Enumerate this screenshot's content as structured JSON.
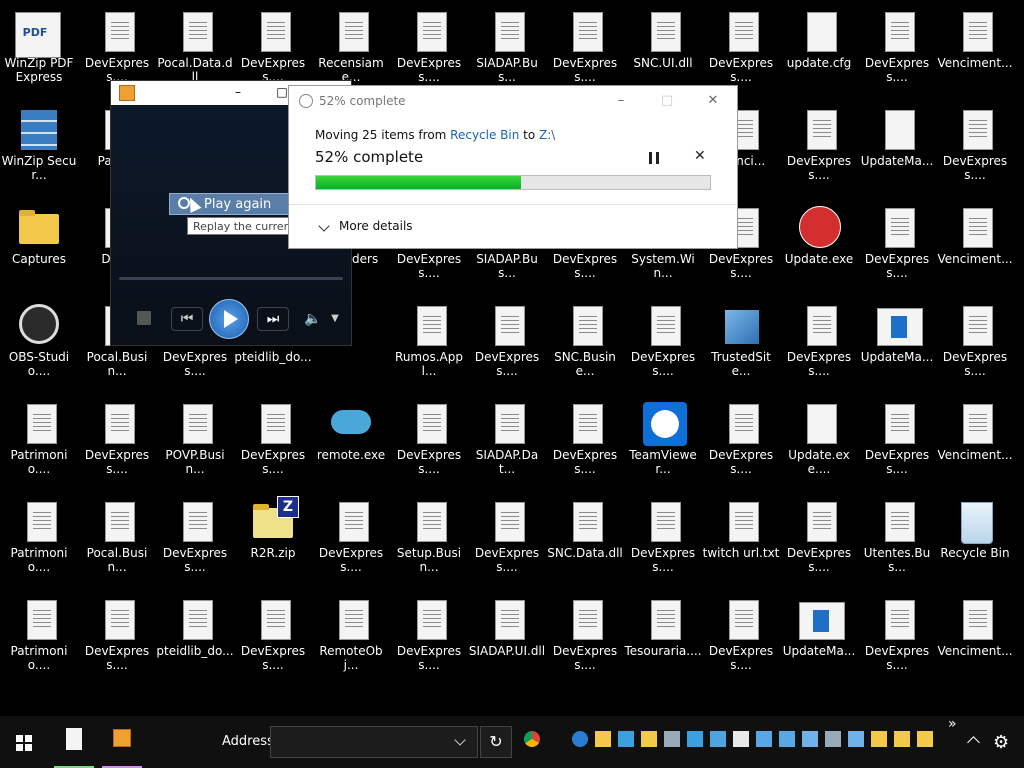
{
  "desktop_icons": [
    {
      "label": "WinZip PDF Express",
      "icon": "winzip-pdf-icon",
      "col": 0,
      "row": 0,
      "style": "pdf"
    },
    {
      "label": "DevExpress....",
      "icon": "file-icon",
      "col": 1,
      "row": 0
    },
    {
      "label": "Pocal.Data.dll",
      "icon": "file-icon",
      "col": 2,
      "row": 0
    },
    {
      "label": "DevExpress....",
      "icon": "file-icon",
      "col": 3,
      "row": 0
    },
    {
      "label": "Recensiame...",
      "icon": "file-icon",
      "col": 4,
      "row": 0
    },
    {
      "label": "DevExpress....",
      "icon": "file-icon",
      "col": 5,
      "row": 0
    },
    {
      "label": "SIADAP.Bus...",
      "icon": "file-icon",
      "col": 6,
      "row": 0
    },
    {
      "label": "DevExpress....",
      "icon": "file-icon",
      "col": 7,
      "row": 0
    },
    {
      "label": "SNC.UI.dll",
      "icon": "file-icon",
      "col": 8,
      "row": 0
    },
    {
      "label": "DevExpress....",
      "icon": "file-icon",
      "col": 9,
      "row": 0
    },
    {
      "label": "update.cfg",
      "icon": "blank-file-icon",
      "col": 10,
      "row": 0,
      "style": "blank"
    },
    {
      "label": "DevExpress....",
      "icon": "file-icon",
      "col": 11,
      "row": 0
    },
    {
      "label": "Venciment...",
      "icon": "file-icon",
      "col": 12,
      "row": 0
    },
    {
      "label": "WinZip Secur...",
      "icon": "winzip-secure-icon",
      "col": 0,
      "row": 1,
      "style": "server"
    },
    {
      "label": "Patrim",
      "icon": "file-icon",
      "col": 1,
      "row": 1
    },
    {
      "label": "erenci...",
      "icon": "file-icon",
      "col": 9,
      "row": 1
    },
    {
      "label": "DevExpress....",
      "icon": "file-icon",
      "col": 10,
      "row": 1
    },
    {
      "label": "UpdateMa...",
      "icon": "blank-file-icon",
      "col": 11,
      "row": 1,
      "style": "blank"
    },
    {
      "label": "DevExpress....",
      "icon": "file-icon",
      "col": 12,
      "row": 1
    },
    {
      "label": "Captures",
      "icon": "folder-icon",
      "col": 0,
      "row": 2,
      "style": "folder"
    },
    {
      "label": "DevE",
      "icon": "file-icon",
      "col": 1,
      "row": 2
    },
    {
      "label": "tent ders",
      "icon": "file-icon",
      "col": 4,
      "row": 2
    },
    {
      "label": "DevExpress....",
      "icon": "file-icon",
      "col": 5,
      "row": 2
    },
    {
      "label": "SIADAP.Bus...",
      "icon": "file-icon",
      "col": 6,
      "row": 2
    },
    {
      "label": "DevExpress....",
      "icon": "file-icon",
      "col": 7,
      "row": 2
    },
    {
      "label": "System.Win...",
      "icon": "file-icon",
      "col": 8,
      "row": 2
    },
    {
      "label": "DevExpress....",
      "icon": "file-icon",
      "col": 9,
      "row": 2
    },
    {
      "label": "Update.exe",
      "icon": "update-exe-icon",
      "col": 10,
      "row": 2,
      "style": "redcirc"
    },
    {
      "label": "DevExpress....",
      "icon": "file-icon",
      "col": 11,
      "row": 2
    },
    {
      "label": "Venciment...",
      "icon": "file-icon",
      "col": 12,
      "row": 2
    },
    {
      "label": "OBS-Studio....",
      "icon": "obs-icon",
      "col": 0,
      "row": 3,
      "style": "obs"
    },
    {
      "label": "Pocal.Busin...",
      "icon": "file-icon",
      "col": 1,
      "row": 3
    },
    {
      "label": "DevExpress....",
      "icon": "file-icon",
      "col": 2,
      "row": 3
    },
    {
      "label": "pteidlib_do...",
      "icon": "file-icon",
      "col": 3,
      "row": 3
    },
    {
      "label": "Rumos.Appl...",
      "icon": "file-icon",
      "col": 5,
      "row": 3
    },
    {
      "label": "DevExpress....",
      "icon": "file-icon",
      "col": 6,
      "row": 3
    },
    {
      "label": "SNC.Busine...",
      "icon": "file-icon",
      "col": 7,
      "row": 3
    },
    {
      "label": "DevExpress....",
      "icon": "file-icon",
      "col": 8,
      "row": 3
    },
    {
      "label": "TrustedSite...",
      "icon": "trusted-site-icon",
      "col": 9,
      "row": 3,
      "style": "cubes"
    },
    {
      "label": "DevExpress....",
      "icon": "file-icon",
      "col": 10,
      "row": 3
    },
    {
      "label": "UpdateMa...",
      "icon": "update-manager-icon",
      "col": 11,
      "row": 3,
      "style": "window"
    },
    {
      "label": "DevExpress....",
      "icon": "file-icon",
      "col": 12,
      "row": 3
    },
    {
      "label": "Patrimonio....",
      "icon": "file-icon",
      "col": 0,
      "row": 4
    },
    {
      "label": "DevExpress....",
      "icon": "file-icon",
      "col": 1,
      "row": 4
    },
    {
      "label": "POVP.Busin...",
      "icon": "file-icon",
      "col": 2,
      "row": 4
    },
    {
      "label": "DevExpress....",
      "icon": "file-icon",
      "col": 3,
      "row": 4
    },
    {
      "label": "remote.exe",
      "icon": "remote-exe-icon",
      "col": 4,
      "row": 4,
      "style": "cloud"
    },
    {
      "label": "DevExpress....",
      "icon": "file-icon",
      "col": 5,
      "row": 4
    },
    {
      "label": "SIADAP.Dat...",
      "icon": "file-icon",
      "col": 6,
      "row": 4
    },
    {
      "label": "DevExpress....",
      "icon": "file-icon",
      "col": 7,
      "row": 4
    },
    {
      "label": "TeamViewer...",
      "icon": "teamviewer-icon",
      "col": 8,
      "row": 4,
      "style": "teamviewer"
    },
    {
      "label": "DevExpress....",
      "icon": "file-icon",
      "col": 9,
      "row": 4
    },
    {
      "label": "Update.exe....",
      "icon": "blank-file-icon",
      "col": 10,
      "row": 4,
      "style": "blank"
    },
    {
      "label": "DevExpress....",
      "icon": "file-icon",
      "col": 11,
      "row": 4
    },
    {
      "label": "Venciment...",
      "icon": "file-icon",
      "col": 12,
      "row": 4
    },
    {
      "label": "Patrimonio....",
      "icon": "file-icon",
      "col": 0,
      "row": 5
    },
    {
      "label": "Pocal.Busin...",
      "icon": "file-icon",
      "col": 1,
      "row": 5
    },
    {
      "label": "DevExpress....",
      "icon": "file-icon",
      "col": 2,
      "row": 5
    },
    {
      "label": "R2R.zip",
      "icon": "zip-folder-icon",
      "col": 3,
      "row": 5,
      "style": "zip"
    },
    {
      "label": "DevExpress....",
      "icon": "file-icon",
      "col": 4,
      "row": 5
    },
    {
      "label": "Setup.Busin...",
      "icon": "file-icon",
      "col": 5,
      "row": 5
    },
    {
      "label": "DevExpress....",
      "icon": "file-icon",
      "col": 6,
      "row": 5
    },
    {
      "label": "SNC.Data.dll",
      "icon": "file-icon",
      "col": 7,
      "row": 5
    },
    {
      "label": "DevExpress....",
      "icon": "file-icon",
      "col": 8,
      "row": 5
    },
    {
      "label": "twitch url.txt",
      "icon": "file-icon",
      "col": 9,
      "row": 5
    },
    {
      "label": "DevExpress....",
      "icon": "file-icon",
      "col": 10,
      "row": 5
    },
    {
      "label": "Utentes.Bus...",
      "icon": "file-icon",
      "col": 11,
      "row": 5
    },
    {
      "label": "Recycle Bin",
      "icon": "recycle-bin-icon",
      "col": 12,
      "row": 5,
      "style": "bin"
    },
    {
      "label": "Patrimonio....",
      "icon": "file-icon",
      "col": 0,
      "row": 6
    },
    {
      "label": "DevExpress....",
      "icon": "file-icon",
      "col": 1,
      "row": 6
    },
    {
      "label": "pteidlib_do...",
      "icon": "file-icon",
      "col": 2,
      "row": 6
    },
    {
      "label": "DevExpress....",
      "icon": "file-icon",
      "col": 3,
      "row": 6
    },
    {
      "label": "RemoteObj...",
      "icon": "file-icon",
      "col": 4,
      "row": 6
    },
    {
      "label": "DevExpress....",
      "icon": "file-icon",
      "col": 5,
      "row": 6
    },
    {
      "label": "SIADAP.UI.dll",
      "icon": "file-icon",
      "col": 6,
      "row": 6
    },
    {
      "label": "DevExpress....",
      "icon": "file-icon",
      "col": 7,
      "row": 6
    },
    {
      "label": "Tesouraria....",
      "icon": "file-icon",
      "col": 8,
      "row": 6
    },
    {
      "label": "DevExpress....",
      "icon": "file-icon",
      "col": 9,
      "row": 6
    },
    {
      "label": "UpdateMa...",
      "icon": "update-manager-icon",
      "col": 10,
      "row": 6,
      "style": "window"
    },
    {
      "label": "DevExpress....",
      "icon": "file-icon",
      "col": 11,
      "row": 6
    },
    {
      "label": "Venciment...",
      "icon": "file-icon",
      "col": 12,
      "row": 6
    }
  ],
  "media_player": {
    "play_again_label": "Play again",
    "tooltip": "Replay the current",
    "icons": [
      "stop-icon",
      "previous-icon",
      "play-icon",
      "next-icon",
      "volume-icon"
    ]
  },
  "copy_dialog": {
    "title": "52% complete",
    "moving_prefix": "Moving 25 items from ",
    "source": "Recycle Bin",
    "to_word": " to ",
    "destination": "Z:\\",
    "percent_text": "52% complete",
    "progress": 0.52,
    "more_details": "More details",
    "progress_color": "#06b025"
  },
  "taskbar": {
    "address_label": "Address",
    "address_value": "",
    "apps": [
      "file-explorer-icon",
      "media-player-icon"
    ],
    "tray_overflow": "»"
  }
}
